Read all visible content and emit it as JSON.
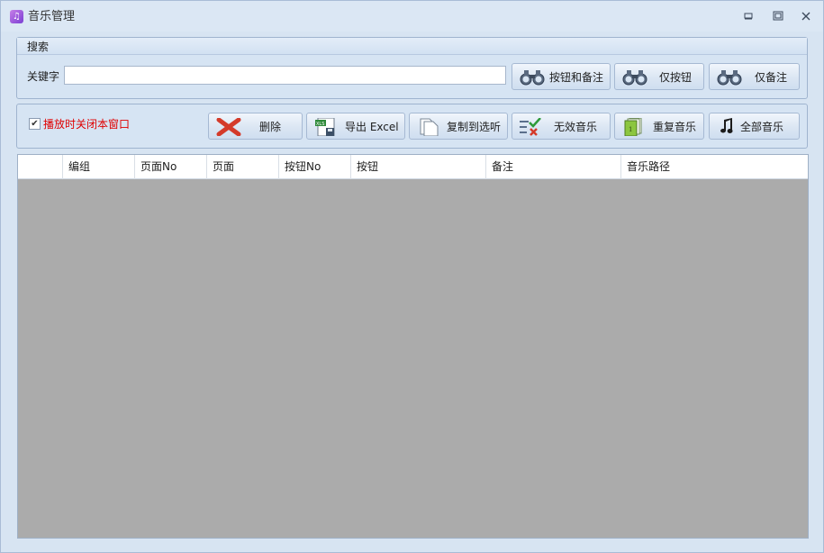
{
  "window": {
    "title": "音乐管理",
    "controls": {
      "minimize": "▭",
      "restore": "⧉",
      "close": "✕"
    }
  },
  "search": {
    "group_title": "搜索",
    "keyword_label": "关键字",
    "keyword_value": "",
    "buttons": {
      "both": "按钮和备注",
      "button_only": "仅按钮",
      "note_only": "仅备注"
    }
  },
  "toolbar": {
    "close_on_play": {
      "label": "播放时关闭本窗口",
      "checked": true
    },
    "buttons": {
      "delete": "删除",
      "export": "导出 Excel",
      "copy": "复制到选听",
      "invalid": "无效音乐",
      "duplicate": "重复音乐",
      "all": "全部音乐"
    }
  },
  "table": {
    "columns": [
      "",
      "编组",
      "页面No",
      "页面",
      "按钮No",
      "按钮",
      "备注",
      "音乐路径"
    ],
    "rows": []
  },
  "colors": {
    "window_bg": "#d7e4f2",
    "grid_bg": "#ababab",
    "checkbox_label": "#e00000"
  }
}
